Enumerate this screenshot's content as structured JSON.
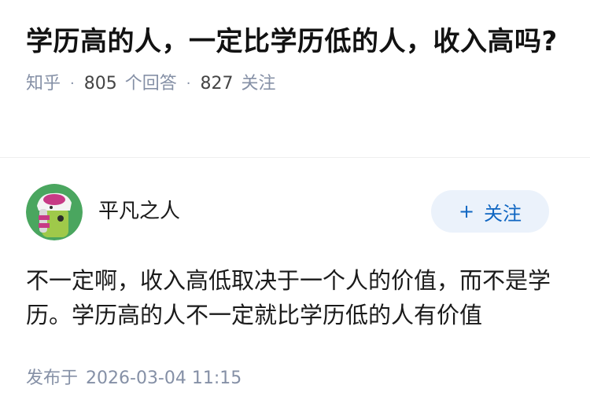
{
  "question": {
    "title": "学历高的人，一定比学历低的人，收入高吗?",
    "source": "知乎",
    "answer_count": "805",
    "answer_label": "个回答",
    "follow_count": "827",
    "follow_label": "关注"
  },
  "answer": {
    "author_name": "平凡之人",
    "follow_button_label": "关注",
    "follow_button_prefix": "+",
    "body": "不一定啊，收入高低取决于一个人的价值，而不是学历。学历高的人不一定就比学历低的人有价值",
    "published_label": "发布于",
    "published_time": "2026-03-04 11:15"
  },
  "colors": {
    "meta_gray": "#8590a6",
    "follow_blue": "#0f66c2",
    "follow_bg": "#ebf2fb"
  },
  "icons": {
    "avatar": "cartoon-avatar-icon"
  }
}
